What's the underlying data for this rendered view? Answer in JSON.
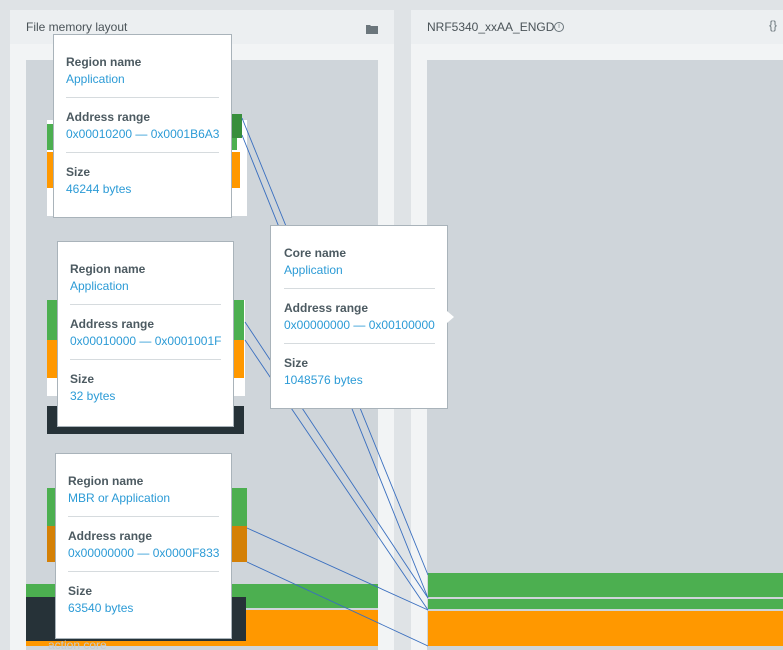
{
  "left_panel": {
    "title": "File memory layout",
    "folder_icon": "folder-icon",
    "bottom_label": "action core"
  },
  "right_panel": {
    "title": "NRF5340_xxAA_ENGD",
    "info_icon": "info-icon",
    "menu_icon": "braces-icon"
  },
  "tooltips": {
    "t1": {
      "region_label": "Region name",
      "region_value": "Application",
      "address_label": "Address range",
      "address_value": "0x00010200 — 0x0001B6A3",
      "size_label": "Size",
      "size_value": "46244 bytes"
    },
    "t2": {
      "region_label": "Region name",
      "region_value": "Application",
      "address_label": "Address range",
      "address_value": "0x00010000 — 0x0001001F",
      "size_label": "Size",
      "size_value": "32 bytes"
    },
    "t3": {
      "region_label": "Region name",
      "region_value": "MBR or Application",
      "address_label": "Address range",
      "address_value": "0x00000000 — 0x0000F833",
      "size_label": "Size",
      "size_value": "63540 bytes"
    },
    "core": {
      "core_label": "Core name",
      "core_value": "Application",
      "address_label": "Address range",
      "address_value": "0x00000000 — 0x00100000",
      "size_label": "Size",
      "size_value": "1048576 bytes"
    }
  },
  "colors": {
    "green": "#4caf50",
    "orange": "#ff9800",
    "link": "#2c9bd6",
    "line": "#3a6fbf"
  }
}
